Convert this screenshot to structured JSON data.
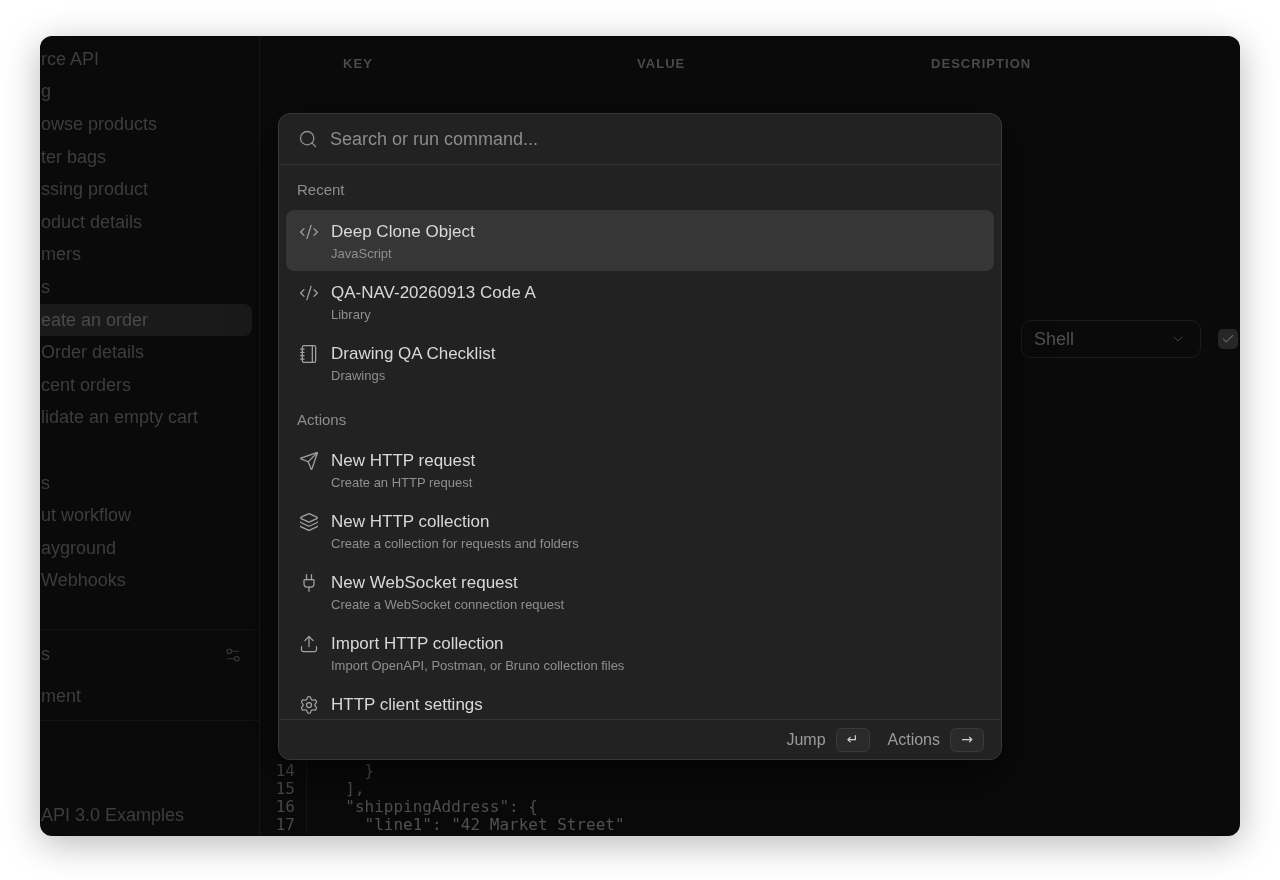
{
  "sidebar": {
    "groups": [
      {
        "items": [
          {
            "label": "rce API",
            "selected": false
          },
          {
            "label": "g",
            "selected": false
          },
          {
            "label": "owse products",
            "selected": false
          },
          {
            "label": "ter bags",
            "selected": false
          },
          {
            "label": "ssing product",
            "selected": false
          },
          {
            "label": "oduct details",
            "selected": false
          },
          {
            "label": "mers",
            "selected": false
          },
          {
            "label": "s",
            "selected": false
          },
          {
            "label": "eate an order",
            "selected": true
          },
          {
            "label": "Order details",
            "selected": false
          },
          {
            "label": "cent orders",
            "selected": false
          },
          {
            "label": "lidate an empty cart",
            "selected": false
          }
        ]
      },
      {
        "items": [
          {
            "label": "s",
            "selected": false
          },
          {
            "label": "ut workflow",
            "selected": false
          },
          {
            "label": "ayground",
            "selected": false
          },
          {
            "label": "Webhooks",
            "selected": false
          }
        ]
      }
    ],
    "environments": {
      "title": "s",
      "items": [
        {
          "label": "ment",
          "selected": false
        }
      ]
    },
    "footer": {
      "label": "API 3.0 Examples"
    }
  },
  "main": {
    "table": {
      "columns": [
        "KEY",
        "VALUE",
        "DESCRIPTION"
      ]
    },
    "select": {
      "value": "Shell"
    },
    "checkbox": {
      "checked": true
    },
    "code_editor": {
      "lines": [
        {
          "number": "14",
          "text": "    }"
        },
        {
          "number": "15",
          "text": "  ],"
        },
        {
          "number": "16",
          "text": "  \"shippingAddress\": {"
        },
        {
          "number": "17",
          "text": "    \"line1\": \"42 Market Street\""
        }
      ]
    }
  },
  "palette": {
    "search": {
      "placeholder": "Search or run command..."
    },
    "sections": [
      {
        "title": "Recent",
        "items": [
          {
            "kind": "code",
            "title": "Deep Clone Object",
            "subtitle": "JavaScript",
            "selected": true
          },
          {
            "kind": "code",
            "title": "QA-NAV-20260913 Code A",
            "subtitle": "Library",
            "selected": false
          },
          {
            "kind": "notebook",
            "title": "Drawing QA Checklist",
            "subtitle": "Drawings",
            "selected": false
          }
        ]
      },
      {
        "title": "Actions",
        "items": [
          {
            "kind": "send",
            "title": "New HTTP request",
            "subtitle": "Create an HTTP request",
            "selected": false
          },
          {
            "kind": "layers",
            "title": "New HTTP collection",
            "subtitle": "Create a collection for requests and folders",
            "selected": false
          },
          {
            "kind": "plug",
            "title": "New WebSocket request",
            "subtitle": "Create a WebSocket connection request",
            "selected": false
          },
          {
            "kind": "upload",
            "title": "Import HTTP collection",
            "subtitle": "Import OpenAPI, Postman, or Bruno collection files",
            "selected": false
          },
          {
            "kind": "gear",
            "title": "HTTP client settings",
            "selected": false
          }
        ]
      }
    ],
    "footer": {
      "hints": [
        {
          "label": "Jump",
          "key": "↵"
        },
        {
          "label": "Actions",
          "key": "→"
        }
      ]
    }
  }
}
